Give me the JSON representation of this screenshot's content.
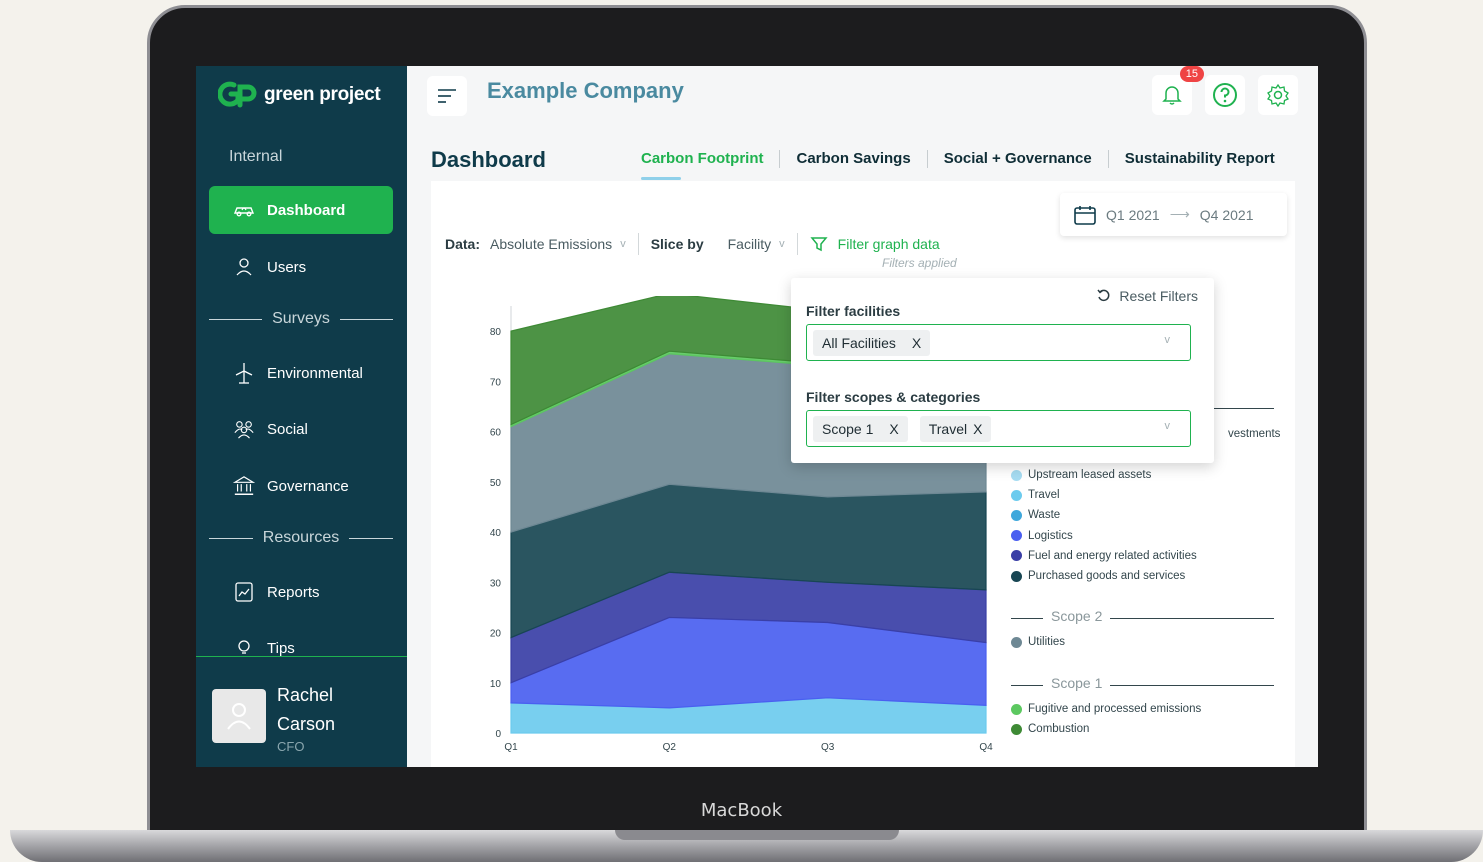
{
  "device_label": "MacBook",
  "app": {
    "logo_text": "green project",
    "company": "Example Company",
    "notifications_count": "15"
  },
  "sidebar": {
    "section_internal": "Internal",
    "items": [
      {
        "label": "Dashboard",
        "icon": "eco-car-icon",
        "active": true
      },
      {
        "label": "Users",
        "icon": "user-icon"
      },
      {
        "label": "Environmental",
        "icon": "wind-turbine-icon"
      },
      {
        "label": "Social",
        "icon": "people-icon"
      },
      {
        "label": "Governance",
        "icon": "bank-icon"
      },
      {
        "label": "Reports",
        "icon": "report-icon"
      },
      {
        "label": "Tips",
        "icon": "lightbulb-icon"
      }
    ],
    "section_surveys": "Surveys",
    "section_resources": "Resources",
    "profile": {
      "first": "Rachel",
      "last": "Carson",
      "role": "CFO"
    }
  },
  "page": {
    "title": "Dashboard",
    "tabs": [
      "Carbon Footprint",
      "Carbon Savings",
      "Social + Governance",
      "Sustainability Report"
    ],
    "active_tab": "Carbon Footprint",
    "date_from": "Q1 2021",
    "date_to": "Q4 2021",
    "controls": {
      "data_label": "Data:",
      "data_value": "Absolute Emissions",
      "slice_label": "Slice by",
      "slice_value": "Facility",
      "filter_link": "Filter graph data",
      "filters_applied": "Filters applied"
    }
  },
  "filter_popup": {
    "reset": "Reset Filters",
    "facilities_title": "Filter facilities",
    "facilities_chips": [
      "All Facilities"
    ],
    "scopes_title": "Filter scopes & categories",
    "scope_chips": [
      "Scope 1",
      "Travel"
    ],
    "chip_remove": "X"
  },
  "legend": {
    "partial_item": "vestments",
    "scope3_items": [
      {
        "label": "Upstream leased assets",
        "color": "#a6dcf2"
      },
      {
        "label": "Travel",
        "color": "#6ccbee"
      },
      {
        "label": "Waste",
        "color": "#3fa8dc"
      },
      {
        "label": "Logistics",
        "color": "#4a5ff0"
      },
      {
        "label": "Fuel and energy related activities",
        "color": "#3a3fa6"
      },
      {
        "label": "Purchased goods and services",
        "color": "#184653"
      }
    ],
    "scope2_label": "Scope 2",
    "scope2_items": [
      {
        "label": "Utilities",
        "color": "#6e8894"
      }
    ],
    "scope1_label": "Scope 1",
    "scope1_items": [
      {
        "label": "Fugitive and processed emissions",
        "color": "#5cc860"
      },
      {
        "label": "Combustion",
        "color": "#3e8a35"
      }
    ]
  },
  "chart_data": {
    "type": "area",
    "stacked": true,
    "categories": [
      "Q1",
      "Q2",
      "Q3",
      "Q4"
    ],
    "ylim": [
      0,
      85
    ],
    "yticks": [
      0,
      10,
      20,
      30,
      40,
      50,
      60,
      70,
      80
    ],
    "series": [
      {
        "name": "Travel",
        "color": "#6ccbee",
        "values": [
          6,
          5,
          7,
          5.5
        ]
      },
      {
        "name": "Logistics",
        "color": "#4a5ff0",
        "values": [
          4,
          18,
          15,
          12.5
        ]
      },
      {
        "name": "Fuel and energy related activities",
        "color": "#3a3fa6",
        "values": [
          9,
          9,
          8,
          10.5
        ]
      },
      {
        "name": "Purchased goods and services",
        "color": "#184653",
        "values": [
          21,
          17.5,
          17,
          19.5
        ]
      },
      {
        "name": "Utilities",
        "color": "#6e8894",
        "values": [
          21,
          26,
          26,
          26
        ]
      },
      {
        "name": "Fugitive and processed emissions",
        "color": "#5cc860",
        "values": [
          0.4,
          0.5,
          0.5,
          0.5
        ]
      },
      {
        "name": "Combustion",
        "color": "#3e8a35",
        "values": [
          18.6,
          11.5,
          10.5,
          12
        ]
      }
    ]
  }
}
